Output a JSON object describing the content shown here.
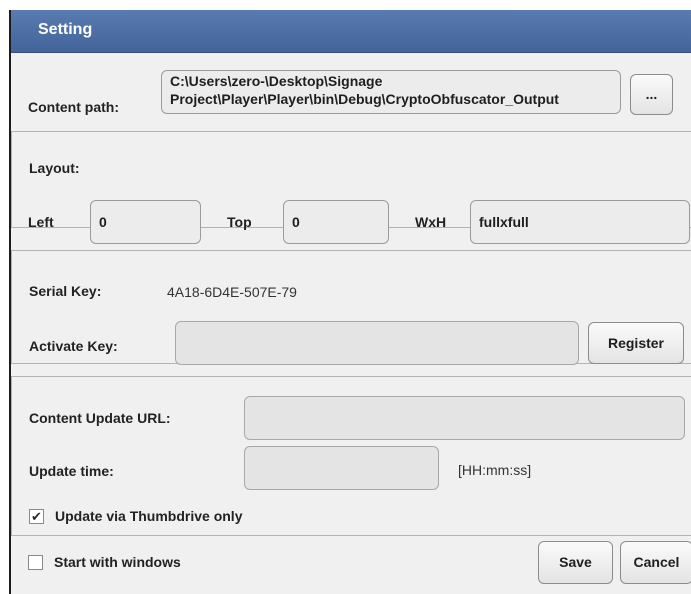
{
  "window": {
    "title": "Setting"
  },
  "content_path": {
    "label": "Content path:",
    "value": "C:\\Users\\zero-\\Desktop\\Signage Project\\Player\\Player\\bin\\Debug\\CryptoObfuscator_Output",
    "browse_label": "..."
  },
  "layout": {
    "heading": "Layout:",
    "left_label": "Left",
    "left_value": "0",
    "top_label": "Top",
    "top_value": "0",
    "size_label": "WxH",
    "size_value": "fullxfull"
  },
  "license": {
    "serial_label": "Serial Key:",
    "serial_value": "4A18-6D4E-507E-79",
    "activate_label": "Activate Key:",
    "activate_value": "",
    "register_label": "Register"
  },
  "update": {
    "url_label": "Content Update URL:",
    "url_value": "",
    "time_label": "Update time:",
    "time_value": "",
    "time_format": "[HH:mm:ss]",
    "thumbdrive_label": "Update via Thumbdrive only",
    "thumbdrive_checked": true
  },
  "footer": {
    "startup_label": "Start with windows",
    "startup_checked": false,
    "save_label": "Save",
    "cancel_label": "Cancel"
  }
}
